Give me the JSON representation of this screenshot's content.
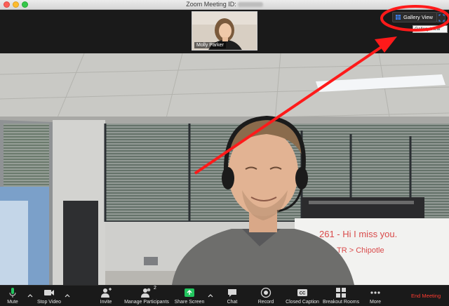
{
  "window": {
    "title": "Zoom Meeting ID:"
  },
  "thumbnail": {
    "name": "Molly Parker"
  },
  "view": {
    "gallery_label": "Gallery View",
    "tooltip": "Gallery View"
  },
  "whiteboard": {
    "line1": "261 - Hi I miss you.",
    "line2": "TR > Chipotle"
  },
  "toolbar": {
    "items": [
      {
        "label": "Mute",
        "icon": "microphone-icon"
      },
      {
        "label": "Stop Video",
        "icon": "video-camera-icon"
      },
      {
        "label": "Invite",
        "icon": "add-user-icon"
      },
      {
        "label": "Manage Participants",
        "icon": "participants-icon"
      },
      {
        "label": "Share Screen",
        "icon": "share-screen-icon"
      },
      {
        "label": "Chat",
        "icon": "chat-icon"
      },
      {
        "label": "Record",
        "icon": "record-icon"
      },
      {
        "label": "Closed Caption",
        "icon": "cc-icon"
      },
      {
        "label": "Breakout Rooms",
        "icon": "breakout-rooms-icon"
      },
      {
        "label": "More",
        "icon": "more-icon"
      }
    ],
    "participants_count": "2",
    "end_meeting": "End Meeting"
  },
  "colors": {
    "accent_green": "#22c55e",
    "end_red": "#ff3b30",
    "annotation_red": "#ff1a1a"
  }
}
